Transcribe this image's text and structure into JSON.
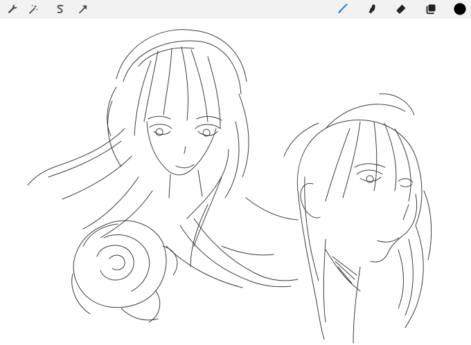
{
  "toolbar": {
    "left_tools": [
      {
        "name": "actions",
        "icon": "wrench-icon"
      },
      {
        "name": "adjustments",
        "icon": "magic-wand-icon"
      },
      {
        "name": "selection",
        "icon": "selection-s-icon"
      },
      {
        "name": "transform",
        "icon": "arrow-cursor-icon"
      }
    ],
    "right_tools": [
      {
        "name": "brush",
        "icon": "brush-icon",
        "active": true
      },
      {
        "name": "smudge",
        "icon": "smudge-finger-icon"
      },
      {
        "name": "eraser",
        "icon": "eraser-icon"
      },
      {
        "name": "layers",
        "icon": "layers-icon"
      },
      {
        "name": "color",
        "icon": "color-swatch-icon"
      }
    ]
  },
  "colors": {
    "toolbar_bg": "#f2f2f2",
    "icon": "#4a4a4a",
    "active_brush": "#2f7fd6",
    "dark_icon": "#222222",
    "current_color": "#000000",
    "canvas_bg": "#ffffff",
    "sketch_stroke": "#3a3a3a"
  }
}
